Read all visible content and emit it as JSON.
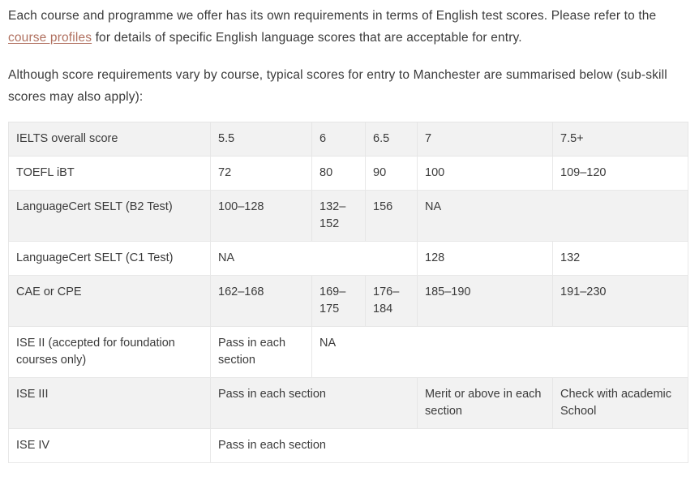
{
  "intro": {
    "paragraph_1_before_link": "Each course and programme we offer has its own requirements in terms of English test scores. Please refer to the ",
    "link_text": "course profiles",
    "paragraph_1_after_link": " for details of specific English language scores that are acceptable for entry.",
    "paragraph_2": "Although score requirements vary by course, typical scores for entry to Manchester are summarised below (sub-skill scores may also apply):"
  },
  "colors": {
    "link": "#b0705f",
    "text": "#3b3b3b",
    "stripe": "#f2f2f2",
    "border": "#e2e2e2",
    "white": "#ffffff"
  },
  "table": {
    "rows": [
      {
        "label": "IELTS overall score",
        "cells": [
          "5.5",
          "6",
          "6.5",
          "7",
          "7.5+"
        ]
      },
      {
        "label": "TOEFL iBT",
        "cells": [
          "72",
          "80",
          "90",
          "100",
          "109–120"
        ]
      },
      {
        "label": "LanguageCert SELT (B2 Test)",
        "cells": [
          "100–128",
          "132–152",
          "156",
          "NA"
        ]
      },
      {
        "label": "LanguageCert SELT (C1 Test)",
        "cells": [
          "NA",
          "128",
          "132"
        ]
      },
      {
        "label": "CAE or CPE",
        "cells": [
          "162–168",
          "169–175",
          "176–184",
          "185–190",
          "191–230"
        ]
      },
      {
        "label": "ISE II (accepted for foundation courses only)",
        "cells": [
          "Pass in each section",
          "NA"
        ]
      },
      {
        "label": "ISE III",
        "cells": [
          "Pass in each section",
          "Merit or above in each section",
          "Check with academic School"
        ]
      },
      {
        "label": "ISE IV",
        "cells": [
          "Pass in each section"
        ]
      }
    ]
  }
}
